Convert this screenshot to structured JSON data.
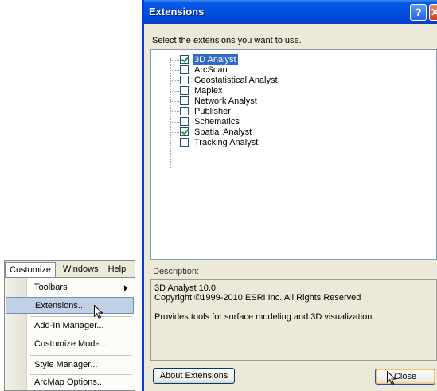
{
  "customize_menu": {
    "menubar": [
      "Customize",
      "Windows",
      "Help"
    ],
    "items": [
      {
        "label": "Toolbars",
        "submenu": true
      },
      {
        "label": "Extensions...",
        "highlighted": true
      },
      {
        "label": "Add-In Manager..."
      },
      {
        "label": "Customize Mode..."
      },
      {
        "label": "Style Manager..."
      },
      {
        "label": "ArcMap Options..."
      }
    ]
  },
  "dialog": {
    "title": "Extensions",
    "help_glyph": "?",
    "close_glyph": "✕",
    "prompt": "Select the extensions you want to use.",
    "extensions": [
      {
        "name": "3D Analyst",
        "checked": true,
        "selected": true
      },
      {
        "name": "ArcScan",
        "checked": false
      },
      {
        "name": "Geostatistical Analyst",
        "checked": false
      },
      {
        "name": "Maplex",
        "checked": false
      },
      {
        "name": "Network Analyst",
        "checked": false
      },
      {
        "name": "Publisher",
        "checked": false
      },
      {
        "name": "Schematics",
        "checked": false
      },
      {
        "name": "Spatial Analyst",
        "checked": true
      },
      {
        "name": "Tracking Analyst",
        "checked": false
      }
    ],
    "description_label": "Description:",
    "description": {
      "line1": "3D Analyst 10.0",
      "line2": "Copyright ©1999-2010 ESRI Inc. All Rights Reserved",
      "line3": "Provides tools for surface modeling and 3D visualization."
    },
    "about_button": "About Extensions",
    "close_button": "Close"
  },
  "colors": {
    "titlebar": "#0050e6",
    "selection": "#316ac5",
    "menu_highlight": "#c2d0e6"
  }
}
